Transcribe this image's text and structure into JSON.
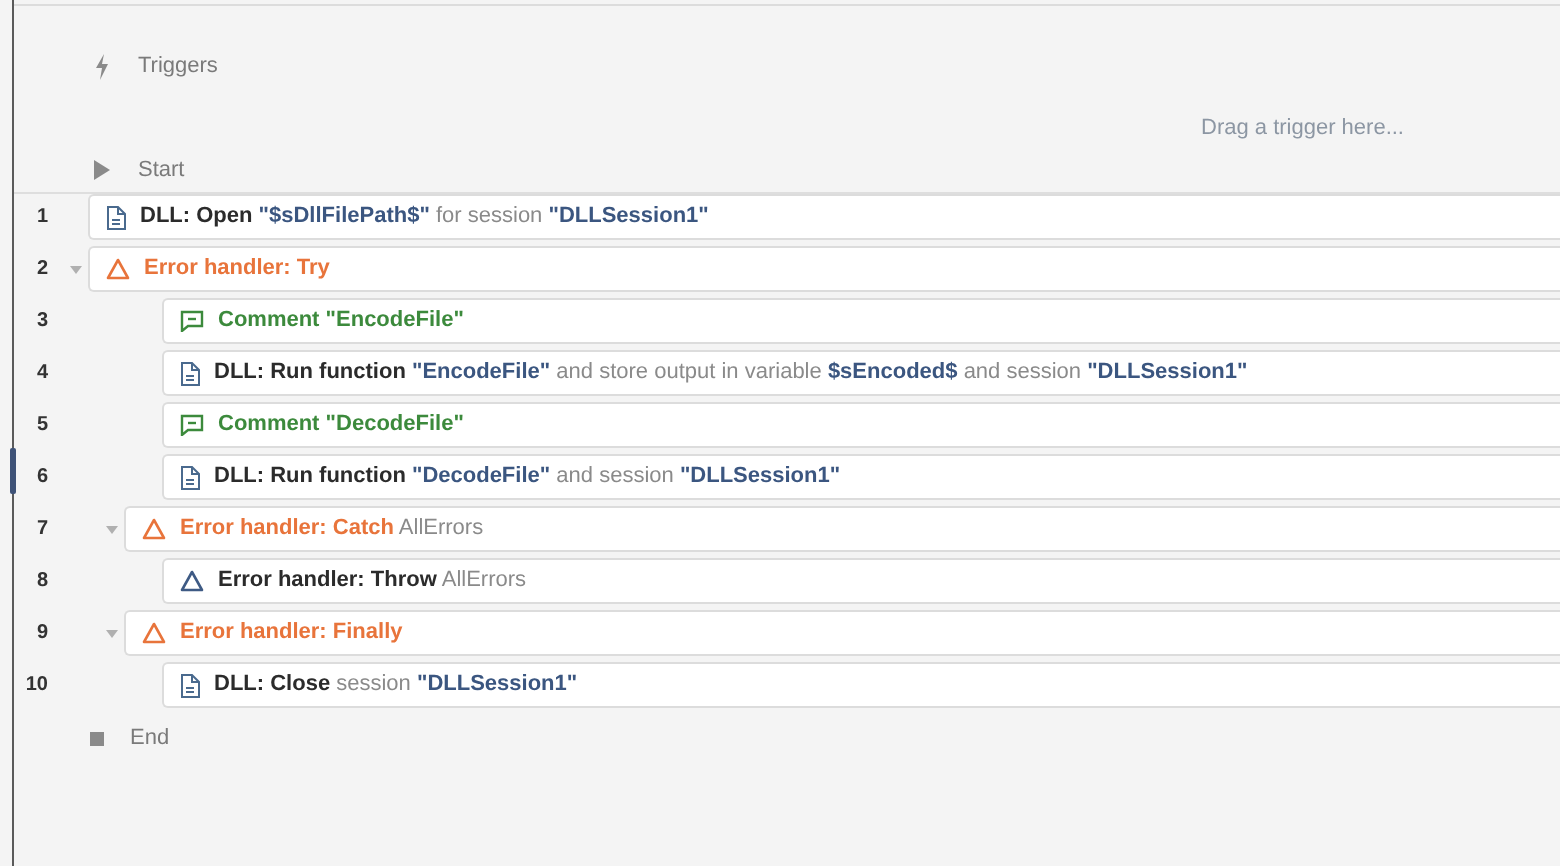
{
  "triggers": {
    "label": "Triggers",
    "placeholder": "Drag a trigger here..."
  },
  "start": {
    "label": "Start"
  },
  "steps": [
    {
      "number": "1",
      "kind": "action",
      "selected": false,
      "parts": [
        {
          "kind": "keyword",
          "text": "DLL: Open"
        },
        {
          "kind": "value",
          "text": "\"$sDllFilePath$\""
        },
        {
          "kind": "plain",
          "text": "for session"
        },
        {
          "kind": "value",
          "text": "\"DLLSession1\""
        }
      ]
    },
    {
      "number": "2",
      "kind": "error",
      "selected": false,
      "expanded": true,
      "parts": [
        {
          "kind": "keyword",
          "text": "Error handler: Try"
        }
      ],
      "children": [
        {
          "number": "3",
          "kind": "comment",
          "selected": false,
          "parts": [
            {
              "kind": "keyword",
              "text": "Comment"
            },
            {
              "kind": "keyword",
              "text": "\"EncodeFile\""
            }
          ]
        },
        {
          "number": "4",
          "kind": "action",
          "selected": false,
          "parts": [
            {
              "kind": "keyword",
              "text": "DLL: Run function"
            },
            {
              "kind": "value",
              "text": "\"EncodeFile\""
            },
            {
              "kind": "plain",
              "text": "and store output in variable"
            },
            {
              "kind": "value",
              "text": "$sEncoded$"
            },
            {
              "kind": "plain",
              "text": "and session"
            },
            {
              "kind": "value",
              "text": "\"DLLSession1\""
            }
          ]
        },
        {
          "number": "5",
          "kind": "comment",
          "selected": false,
          "parts": [
            {
              "kind": "keyword",
              "text": "Comment"
            },
            {
              "kind": "keyword",
              "text": "\"DecodeFile\""
            }
          ]
        },
        {
          "number": "6",
          "kind": "action",
          "selected": true,
          "parts": [
            {
              "kind": "keyword",
              "text": "DLL: Run function"
            },
            {
              "kind": "value",
              "text": "\"DecodeFile\""
            },
            {
              "kind": "plain",
              "text": "and session"
            },
            {
              "kind": "value",
              "text": "\"DLLSession1\""
            }
          ]
        }
      ],
      "handlers": [
        {
          "number": "7",
          "kind": "error",
          "selected": false,
          "expanded": true,
          "parts": [
            {
              "kind": "keyword",
              "text": "Error handler: Catch"
            },
            {
              "kind": "plain",
              "text": "AllErrors"
            }
          ],
          "children": [
            {
              "number": "8",
              "kind": "throw",
              "selected": false,
              "parts": [
                {
                  "kind": "keyword",
                  "text": "Error handler: Throw"
                },
                {
                  "kind": "plain",
                  "text": "AllErrors"
                }
              ]
            }
          ]
        },
        {
          "number": "9",
          "kind": "error",
          "selected": false,
          "expanded": true,
          "parts": [
            {
              "kind": "keyword",
              "text": "Error handler: Finally"
            }
          ],
          "children": [
            {
              "number": "10",
              "kind": "action",
              "selected": false,
              "parts": [
                {
                  "kind": "keyword",
                  "text": "DLL: Close"
                },
                {
                  "kind": "plain",
                  "text": "session"
                },
                {
                  "kind": "value",
                  "text": "\"DLLSession1\""
                }
              ]
            }
          ]
        }
      ]
    }
  ],
  "end": {
    "label": "End"
  }
}
